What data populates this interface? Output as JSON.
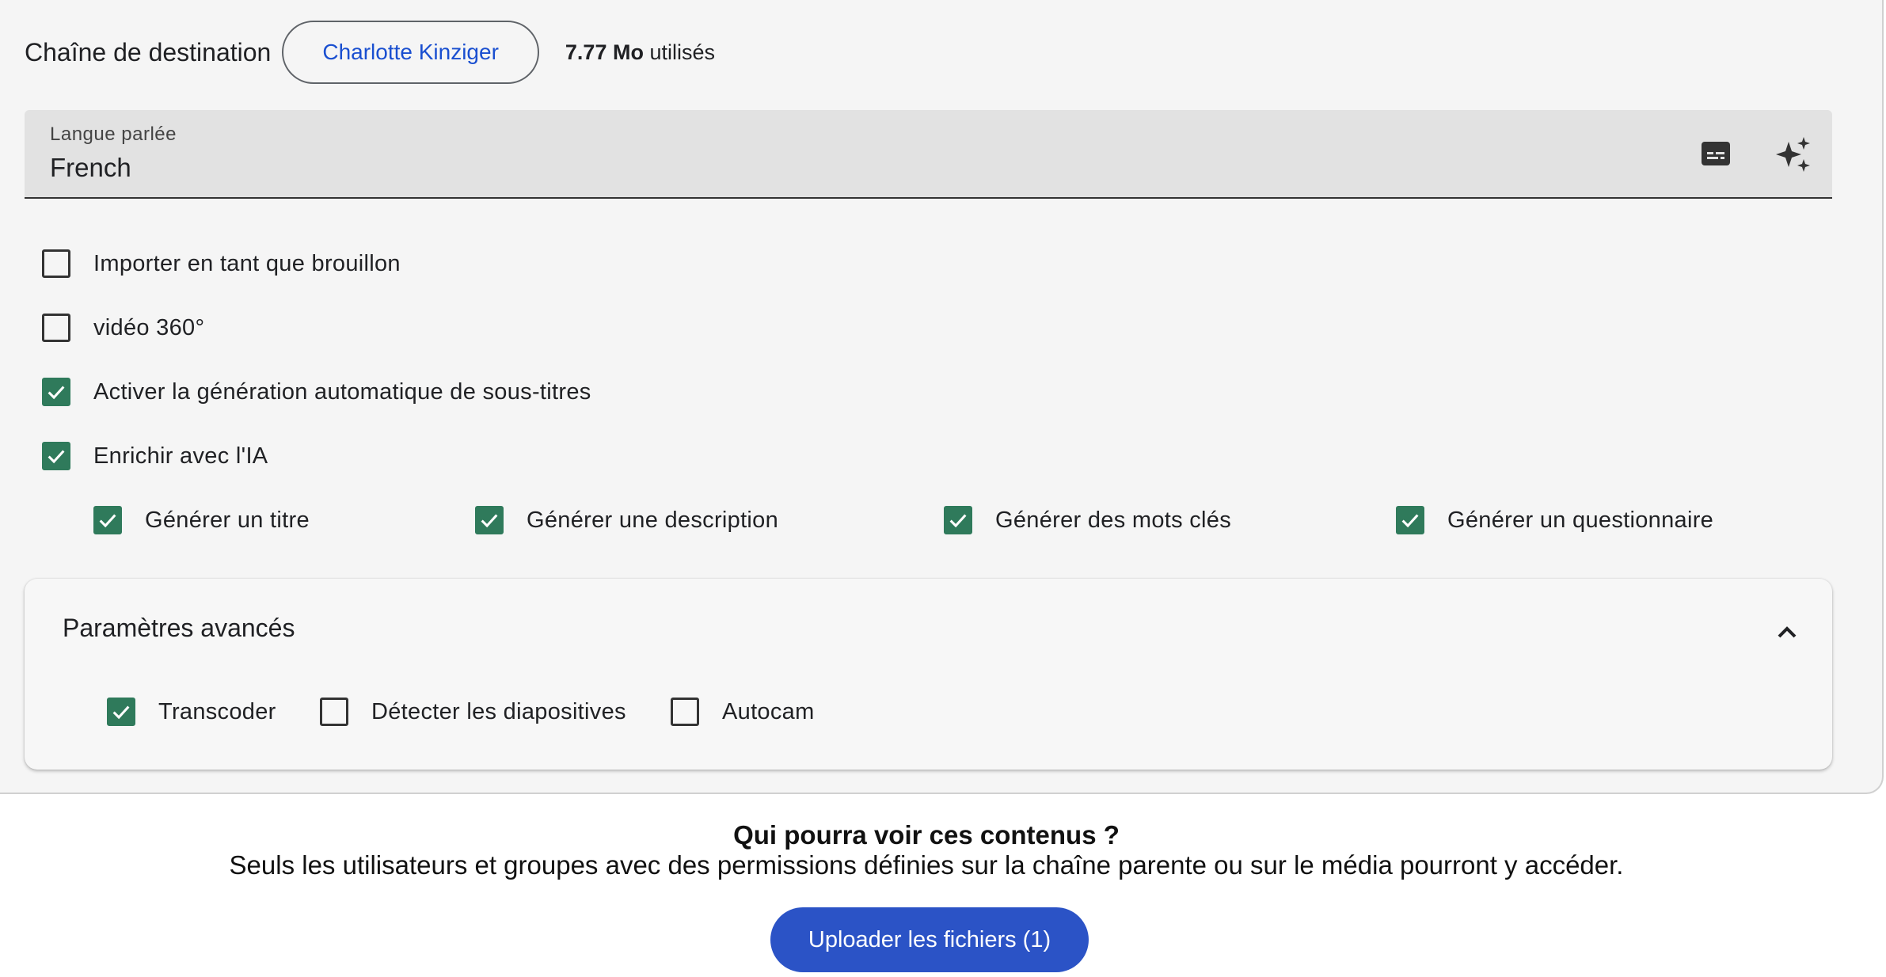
{
  "destination": {
    "label": "Chaîne de destination",
    "channel_name": "Charlotte Kinziger",
    "usage_value": "7.77 Mo",
    "usage_suffix": "utilisés"
  },
  "language_field": {
    "label": "Langue parlée",
    "value": "French",
    "icons": [
      "subtitles-icon",
      "ai-sparkle-icon"
    ]
  },
  "options": [
    {
      "label": "Importer en tant que brouillon",
      "checked": false
    },
    {
      "label": "vidéo 360°",
      "checked": false
    },
    {
      "label": "Activer la génération automatique de sous-titres",
      "checked": true
    },
    {
      "label": "Enrichir avec l'IA",
      "checked": true
    }
  ],
  "ai_options": [
    {
      "label": "Générer un titre",
      "checked": true
    },
    {
      "label": "Générer une description",
      "checked": true
    },
    {
      "label": "Générer des mots clés",
      "checked": true
    },
    {
      "label": "Générer un questionnaire",
      "checked": true
    }
  ],
  "advanced": {
    "title": "Paramètres avancés",
    "expanded": true,
    "options": [
      {
        "label": "Transcoder",
        "checked": true
      },
      {
        "label": "Détecter les diapositives",
        "checked": false
      },
      {
        "label": "Autocam",
        "checked": false
      }
    ]
  },
  "visibility": {
    "title": "Qui pourra voir ces contenus ?",
    "description": "Seuls les utilisateurs et groupes avec des permissions définies sur la chaîne parente ou sur le média pourront y accéder."
  },
  "upload_button": "Uploader les fichiers (1)",
  "colors": {
    "checkbox_checked": "#2f7a5b",
    "primary_button": "#2b53c6",
    "channel_text": "#1a4fd0"
  }
}
